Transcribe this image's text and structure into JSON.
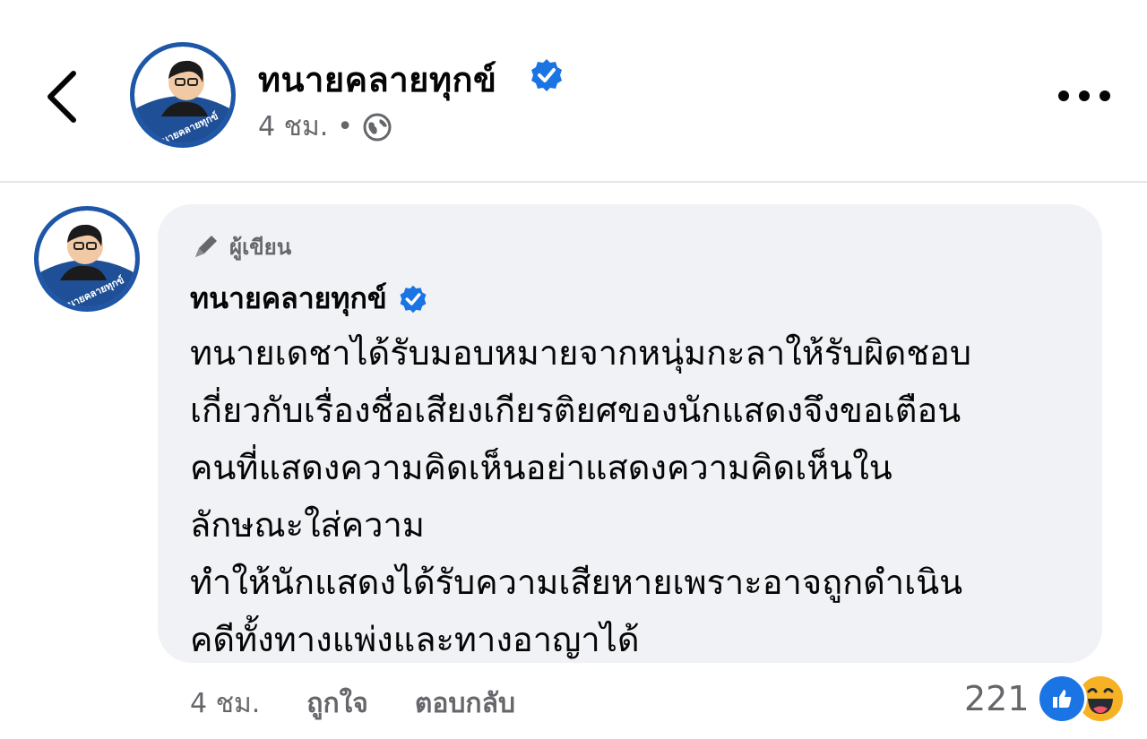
{
  "post": {
    "page_name": "ทนายคลายทุกข์",
    "time": "4 ชม.",
    "separator": "•",
    "avatar_text": "ทนายคลายทุกข์"
  },
  "comment": {
    "author_badge": "ผู้เขียน",
    "author_name": "ทนายคลายทุกข์",
    "text": "ทนายเดชาได้รับมอบหมายจากหนุ่มกะลาให้รับผิดชอบ\nเกี่ยวกับเรื่องชื่อเสียงเกียรติยศของนักแสดงจึงขอเตือน\nคนที่แสดงความคิดเห็นอย่าแสดงความคิดเห็นใน\nลักษณะใส่ความ\nทำให้นักแสดงได้รับความเสียหายเพราะอาจถูกดำเนิน\nคดีทั้งทางแพ่งและทางอาญาได้",
    "time": "4 ชม.",
    "like_label": "ถูกใจ",
    "reply_label": "ตอบกลับ",
    "reaction_count": "221"
  },
  "icons": {
    "back": "chevron-left-icon",
    "verified": "verified-badge-icon",
    "globe": "globe-icon",
    "more": "more-horizontal-icon",
    "pen": "pen-icon",
    "like": "like-reaction-icon",
    "haha": "haha-reaction-icon"
  },
  "colors": {
    "verified": "#1b74e4",
    "secondary_text": "#65676b",
    "bubble": "#f0f2f5"
  }
}
